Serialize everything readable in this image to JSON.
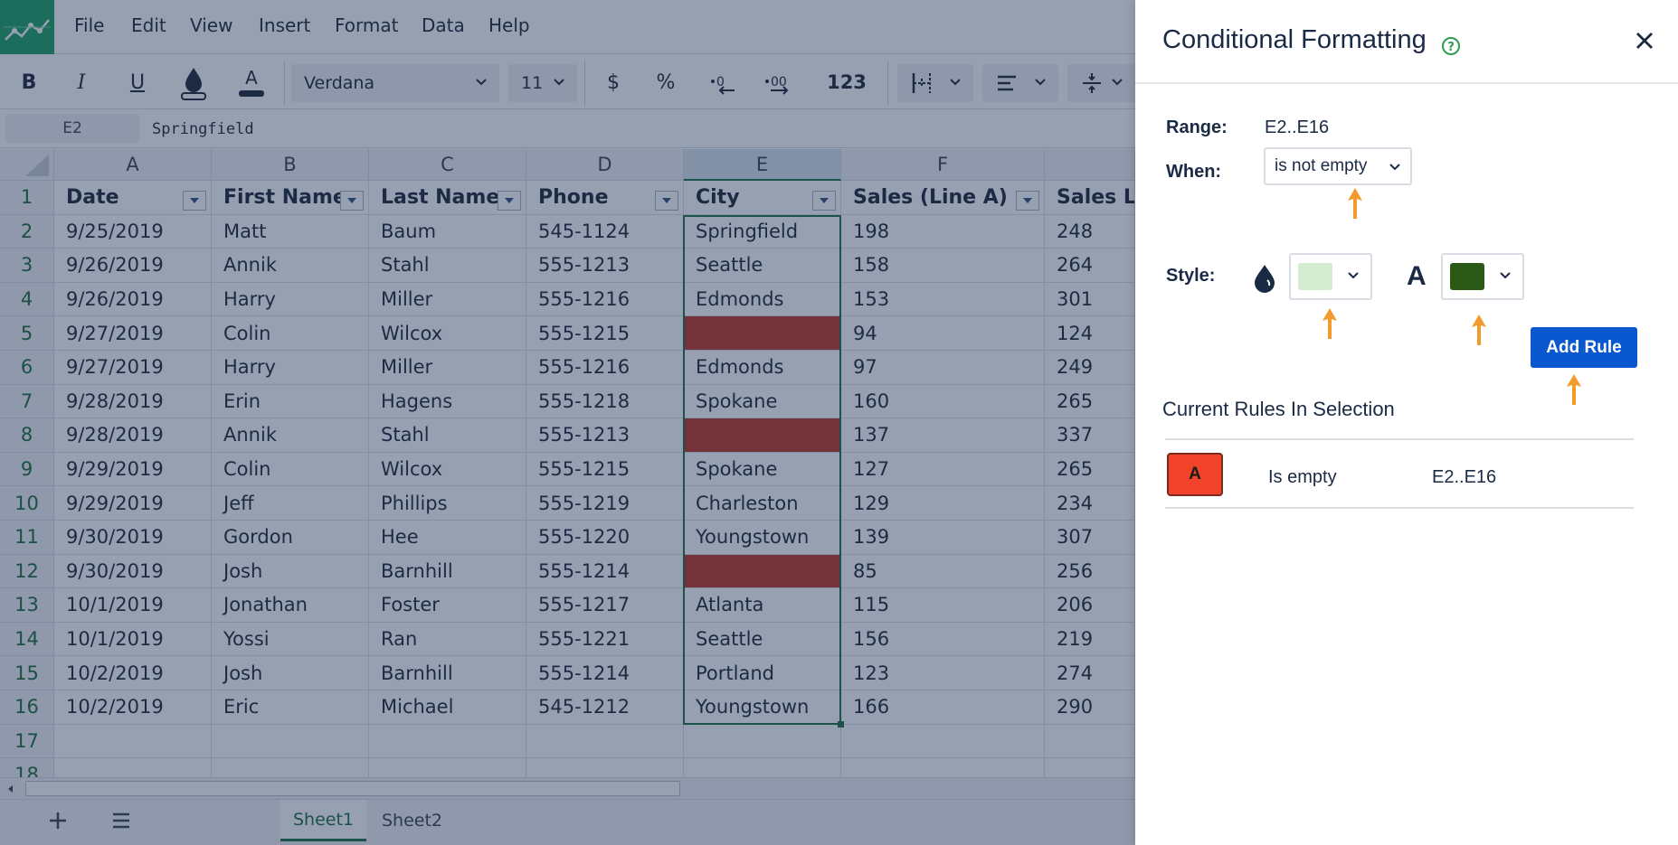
{
  "menu": [
    "File",
    "Edit",
    "View",
    "Insert",
    "Format",
    "Data",
    "Help"
  ],
  "toolbar": {
    "bold": "B",
    "italic": "I",
    "underline": "U",
    "font_color_glyph": "A",
    "font_name": "Verdana",
    "font_size": "11",
    "currency": "$",
    "percent": "%",
    "number_format": "123"
  },
  "formula_bar": {
    "cell_ref": "E2",
    "value": "Springfield"
  },
  "grid": {
    "columns": [
      "A",
      "B",
      "C",
      "D",
      "E",
      "F"
    ],
    "header_row": [
      "Date",
      "First Name",
      "Last Name",
      "Phone",
      "City",
      "Sales (Line A)",
      "Sales L"
    ],
    "rows": [
      {
        "n": "2",
        "cells": [
          "9/25/2019",
          "Matt",
          "Baum",
          "545-1124",
          "Springfield",
          "198",
          "248"
        ]
      },
      {
        "n": "3",
        "cells": [
          "9/26/2019",
          "Annik",
          "Stahl",
          "555-1213",
          "Seattle",
          "158",
          "264"
        ]
      },
      {
        "n": "4",
        "cells": [
          "9/26/2019",
          "Harry",
          "Miller",
          "555-1216",
          "Edmonds",
          "153",
          "301"
        ]
      },
      {
        "n": "5",
        "cells": [
          "9/27/2019",
          "Colin",
          "Wilcox",
          "555-1215",
          "",
          "94",
          "124"
        ]
      },
      {
        "n": "6",
        "cells": [
          "9/27/2019",
          "Harry",
          "Miller",
          "555-1216",
          "Edmonds",
          "97",
          "249"
        ]
      },
      {
        "n": "7",
        "cells": [
          "9/28/2019",
          "Erin",
          "Hagens",
          "555-1218",
          "Spokane",
          "160",
          "265"
        ]
      },
      {
        "n": "8",
        "cells": [
          "9/28/2019",
          "Annik",
          "Stahl",
          "555-1213",
          "",
          "137",
          "337"
        ]
      },
      {
        "n": "9",
        "cells": [
          "9/29/2019",
          "Colin",
          "Wilcox",
          "555-1215",
          "Spokane",
          "127",
          "265"
        ]
      },
      {
        "n": "10",
        "cells": [
          "9/29/2019",
          "Jeff",
          "Phillips",
          "555-1219",
          "Charleston",
          "129",
          "234"
        ]
      },
      {
        "n": "11",
        "cells": [
          "9/30/2019",
          "Gordon",
          "Hee",
          "555-1220",
          "Youngstown",
          "139",
          "307"
        ]
      },
      {
        "n": "12",
        "cells": [
          "9/30/2019",
          "Josh",
          "Barnhill",
          "555-1214",
          "",
          "85",
          "256"
        ]
      },
      {
        "n": "13",
        "cells": [
          "10/1/2019",
          "Jonathan",
          "Foster",
          "555-1217",
          "Atlanta",
          "115",
          "206"
        ]
      },
      {
        "n": "14",
        "cells": [
          "10/1/2019",
          "Yossi",
          "Ran",
          "555-1221",
          "Seattle",
          "156",
          "219"
        ]
      },
      {
        "n": "15",
        "cells": [
          "10/2/2019",
          "Josh",
          "Barnhill",
          "555-1214",
          "Portland",
          "123",
          "274"
        ]
      },
      {
        "n": "16",
        "cells": [
          "10/2/2019",
          "Eric",
          "Michael",
          "545-1212",
          "Youngstown",
          "166",
          "290"
        ]
      }
    ],
    "extra_rows": [
      "17",
      "18"
    ],
    "header_row_number": "1",
    "empty_highlight_color": "#c0392b"
  },
  "sheets": [
    "Sheet1",
    "Sheet2"
  ],
  "panel": {
    "title": "Conditional Formatting",
    "range_label": "Range:",
    "range_value": "E2..E16",
    "when_label": "When:",
    "when_value": "is not empty",
    "style_label": "Style:",
    "fill_color": "#d6ecd2",
    "text_color": "#2b5a16",
    "text_color_glyph": "A",
    "add_rule": "Add Rule",
    "current_rules_title": "Current Rules In Selection",
    "rules": [
      {
        "badge": "A",
        "condition": "Is empty",
        "range": "E2..E16",
        "badge_color": "#f0432a"
      }
    ]
  }
}
